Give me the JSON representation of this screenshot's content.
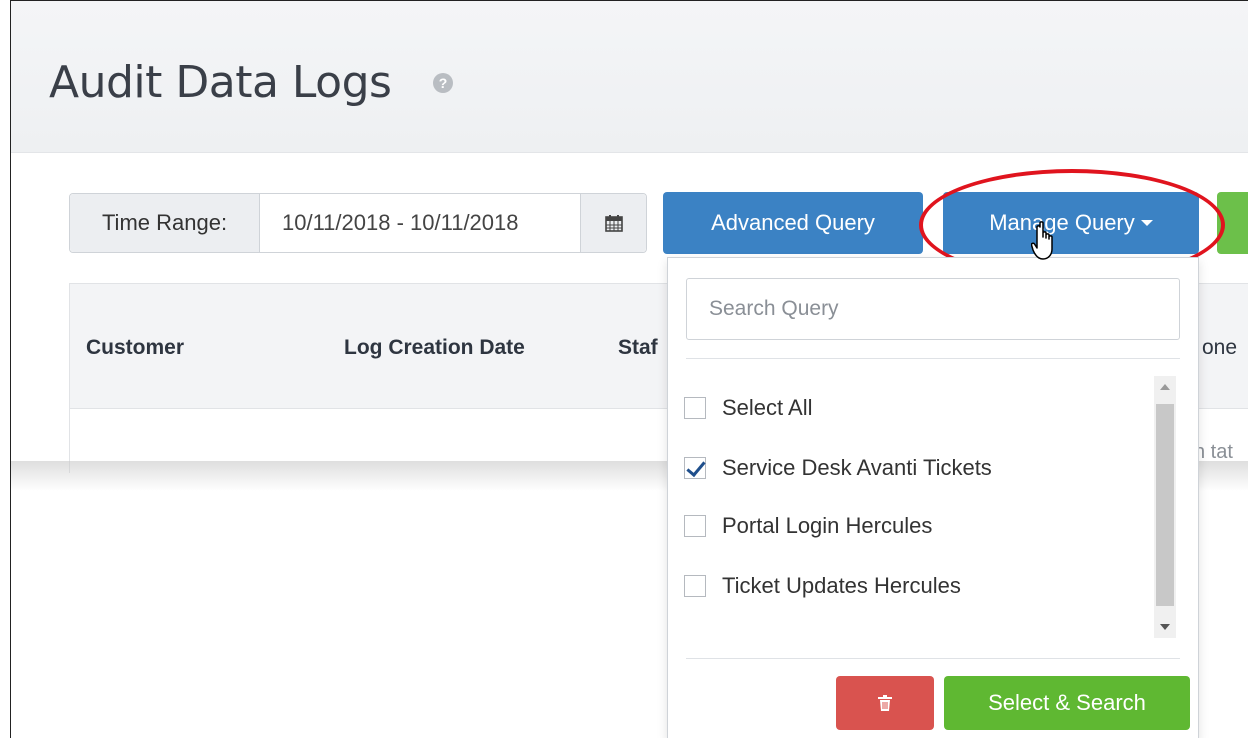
{
  "page": {
    "title": "Audit Data Logs"
  },
  "time_range": {
    "label": "Time Range:",
    "value": "10/11/2018 - 10/11/2018"
  },
  "toolbar": {
    "advanced_query_label": "Advanced Query",
    "manage_query_label": "Manage Query"
  },
  "table": {
    "columns": [
      "Customer",
      "Log Creation Date",
      "Staf",
      "one"
    ],
    "empty_fragment": "n tat"
  },
  "manage_query_menu": {
    "search_placeholder": "Search Query",
    "items": [
      {
        "label": "Select All",
        "checked": false
      },
      {
        "label": "Service Desk Avanti Tickets",
        "checked": true
      },
      {
        "label": "Portal Login Hercules",
        "checked": false
      },
      {
        "label": "Ticket Updates Hercules",
        "checked": false
      }
    ],
    "select_search_label": "Select & Search"
  },
  "colors": {
    "primary": "#3b82c4",
    "success": "#5fb832",
    "danger": "#d9534f",
    "highlight": "#e0141e"
  },
  "icons": [
    "help-icon",
    "calendar-icon",
    "caret-down-icon",
    "trash-icon",
    "hand-cursor-icon",
    "check-icon"
  ]
}
